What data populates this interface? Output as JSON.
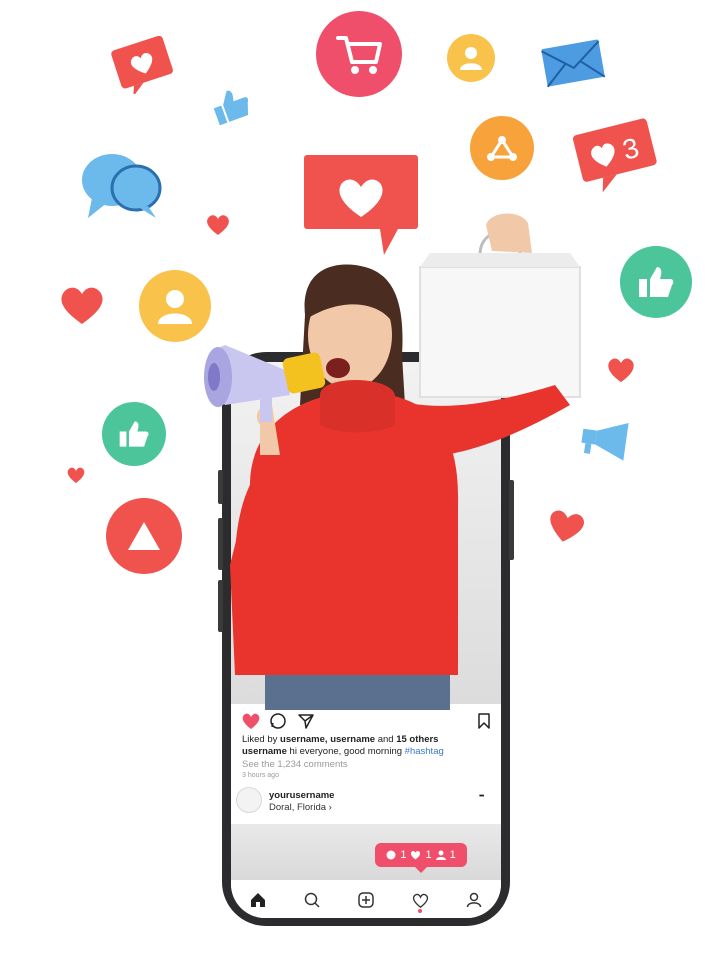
{
  "post": {
    "liked_prefix": "Liked by",
    "liked_users": "username, username",
    "liked_and": "and",
    "liked_others": "15 others",
    "caption_user": "username",
    "caption_text": "hi everyone, good morning",
    "caption_hashtag": "#hashtag",
    "comments_link": "See the 1,234 comments",
    "time_ago": "3 hours ago"
  },
  "account": {
    "username": "yourusername",
    "location": "Doral, Florida",
    "location_chevron": "›",
    "more": "•••"
  },
  "notification": {
    "comments": "1",
    "likes": "1",
    "followers": "1"
  },
  "floating_badge": {
    "count": "3"
  },
  "icons": [
    "heart-bubble-icon",
    "shopping-cart-icon",
    "user-icon",
    "envelope-icon",
    "thumbs-up-icon",
    "chat-bubbles-icon",
    "share-icon",
    "heart-notification-icon",
    "heart-icon",
    "like-badge-icon",
    "megaphone-icon",
    "triangle-play-icon"
  ],
  "colors": {
    "red": "#f0524d",
    "pink": "#ef4f6a",
    "yellow": "#f9c24a",
    "orange": "#f7a23b",
    "blue": "#6cb9ec",
    "green": "#4cc59a",
    "sweater": "#e8342d"
  }
}
